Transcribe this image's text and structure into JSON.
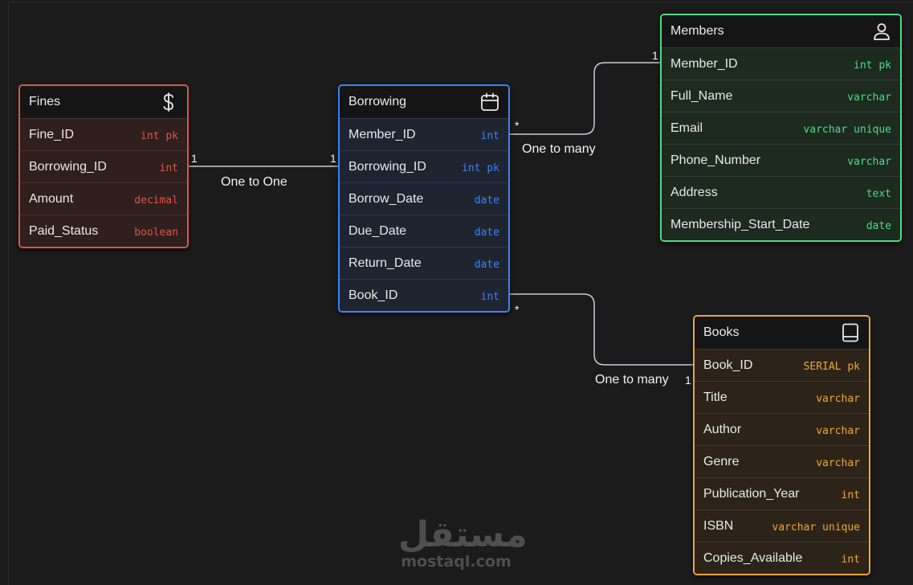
{
  "tables": {
    "fines": {
      "title": "Fines",
      "icon": "dollar-icon",
      "color": "#d9574a",
      "body_bg": "#2f1f1d",
      "rows": [
        {
          "name": "Fine_ID",
          "type": "int pk"
        },
        {
          "name": "Borrowing_ID",
          "type": "int"
        },
        {
          "name": "Amount",
          "type": "decimal"
        },
        {
          "name": "Paid_Status",
          "type": "boolean"
        }
      ]
    },
    "borrowing": {
      "title": "Borrowing",
      "icon": "calendar-icon",
      "color": "#3b82f6",
      "body_bg": "#1e2531",
      "rows": [
        {
          "name": "Member_ID",
          "type": "int"
        },
        {
          "name": "Borrowing_ID",
          "type": "int pk"
        },
        {
          "name": "Borrow_Date",
          "type": "date"
        },
        {
          "name": "Due_Date",
          "type": "date"
        },
        {
          "name": "Return_Date",
          "type": "date"
        },
        {
          "name": "Book_ID",
          "type": "int"
        }
      ]
    },
    "members": {
      "title": "Members",
      "icon": "user-icon",
      "color": "#4ade80",
      "body_bg": "#1c2a20",
      "rows": [
        {
          "name": "Member_ID",
          "type": "int pk"
        },
        {
          "name": "Full_Name",
          "type": "varchar"
        },
        {
          "name": "Email",
          "type": "varchar unique"
        },
        {
          "name": "Phone_Number",
          "type": "varchar"
        },
        {
          "name": "Address",
          "type": "text"
        },
        {
          "name": "Membership_Start_Date",
          "type": "date"
        }
      ]
    },
    "books": {
      "title": "Books",
      "icon": "book-icon",
      "color": "#f0a43a",
      "body_bg": "#2d2419",
      "rows": [
        {
          "name": "Book_ID",
          "type": "SERIAL pk"
        },
        {
          "name": "Title",
          "type": "varchar"
        },
        {
          "name": "Author",
          "type": "varchar"
        },
        {
          "name": "Genre",
          "type": "varchar"
        },
        {
          "name": "Publication_Year",
          "type": "int"
        },
        {
          "name": "ISBN",
          "type": "varchar unique"
        },
        {
          "name": "Copies_Available",
          "type": "int"
        }
      ]
    }
  },
  "relations": [
    {
      "label": "One to One",
      "from_mark": "1",
      "to_mark": "1"
    },
    {
      "label": "One to many",
      "from_mark": "*",
      "to_mark": "1"
    },
    {
      "label": "One to many",
      "from_mark": "*",
      "to_mark": "1"
    }
  ],
  "watermark": {
    "arabic": "مستقل",
    "latin": "mostaql.com"
  }
}
